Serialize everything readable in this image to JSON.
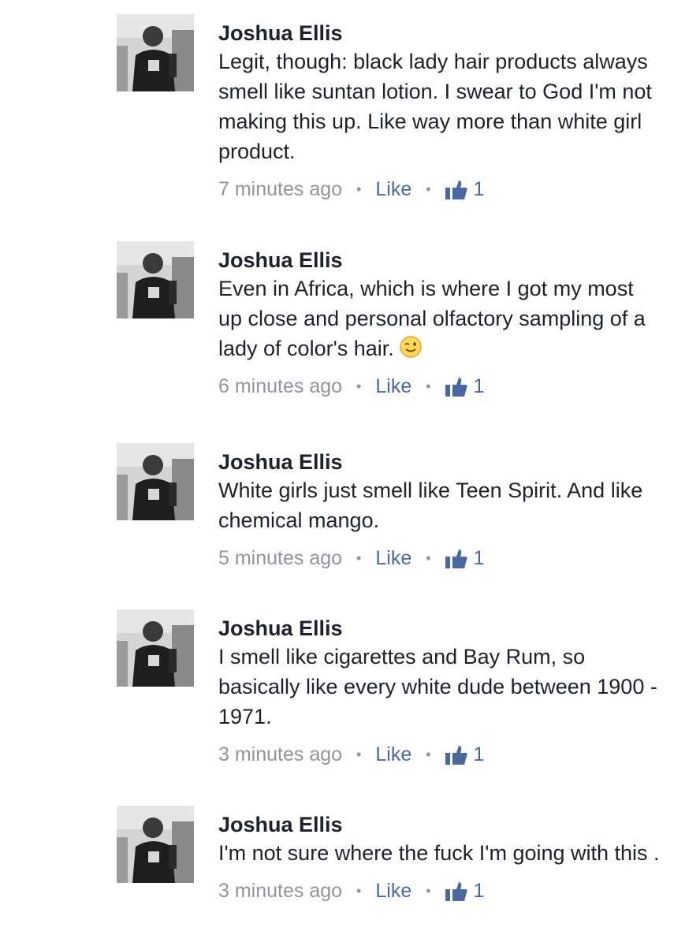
{
  "colors": {
    "author": "#1d2129",
    "text": "#1d2129",
    "meta": "#90949c",
    "link": "#4b67a1"
  },
  "comments": [
    {
      "author": "Joshua Ellis",
      "text": "Legit, though: black lady hair products always smell like suntan lotion. I swear to God I'm not making this up. Like way more than white girl product.",
      "time": "7 minutes ago",
      "like_label": "Like",
      "like_count": "1",
      "avatar_icon": "profile-photo",
      "like_icon": "thumbs-up-icon"
    },
    {
      "author": "Joshua Ellis",
      "text": "Even in Africa, which is where I got my most up close and personal olfactory sampling of a lady of color's hair.",
      "emoji": "winking-face-emoji",
      "time": "6 minutes ago",
      "like_label": "Like",
      "like_count": "1",
      "avatar_icon": "profile-photo",
      "like_icon": "thumbs-up-icon"
    },
    {
      "author": "Joshua Ellis",
      "text": "White girls just smell like Teen Spirit. And like chemical mango.",
      "time": "5 minutes ago",
      "like_label": "Like",
      "like_count": "1",
      "avatar_icon": "profile-photo",
      "like_icon": "thumbs-up-icon"
    },
    {
      "author": "Joshua Ellis",
      "text": "I smell like cigarettes and Bay Rum, so basically like every white dude between 1900 - 1971.",
      "time": "3 minutes ago",
      "like_label": "Like",
      "like_count": "1",
      "avatar_icon": "profile-photo",
      "like_icon": "thumbs-up-icon"
    },
    {
      "author": "Joshua Ellis",
      "text": "I'm not sure where the fuck I'm going with this .",
      "time": "3 minutes ago",
      "like_label": "Like",
      "like_count": "1",
      "avatar_icon": "profile-photo",
      "like_icon": "thumbs-up-icon"
    }
  ]
}
